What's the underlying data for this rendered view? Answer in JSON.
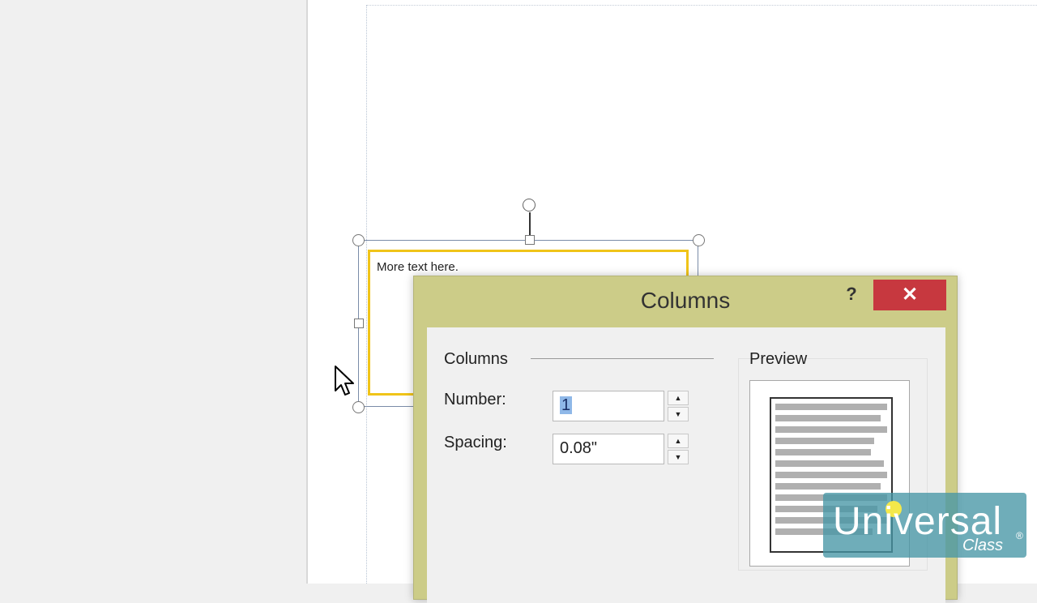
{
  "textbox": {
    "text": "More text here."
  },
  "dialog": {
    "title": "Columns",
    "help_label": "?",
    "close_label": "✕",
    "section_label": "Columns",
    "number": {
      "label": "Number:",
      "value": "1"
    },
    "spacing": {
      "label": "Spacing:",
      "value": "0.08\""
    },
    "preview_label": "Preview",
    "spin_up": "▲",
    "spin_down": "▼"
  },
  "watermark": {
    "main": "Universal",
    "sub": "Class",
    "registered": "®"
  },
  "colors": {
    "dialog_frame": "#cccc88",
    "close_button": "#c7383f",
    "textbox_border": "#f0c419",
    "selection_highlight": "#8fb8e8",
    "watermark_bg": "#4696a5"
  },
  "icons": [
    "mouse-cursor-icon",
    "close-icon",
    "help-icon",
    "spin-up-icon",
    "spin-down-icon"
  ]
}
